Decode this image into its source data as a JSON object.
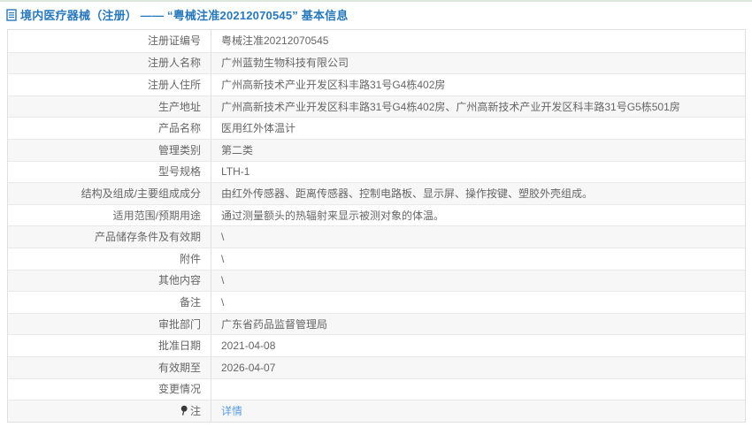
{
  "header": {
    "title": "境内医疗器械（注册） —— “粤械注准20212070545” 基本信息",
    "icon": "document-icon"
  },
  "colors": {
    "title_blue": "#2878bb",
    "link_blue": "#5b9de0",
    "row_alt": "#f7f7f7",
    "border": "#e0e0e0",
    "text": "#666666",
    "top_line": "#dde9dd"
  },
  "table": {
    "rows": [
      {
        "label": "注册证编号",
        "value": "粤械注准20212070545"
      },
      {
        "label": "注册人名称",
        "value": "广州蓝勃生物科技有限公司"
      },
      {
        "label": "注册人住所",
        "value": "广州高新技术产业开发区科丰路31号G4栋402房"
      },
      {
        "label": "生产地址",
        "value": "广州高新技术产业开发区科丰路31号G4栋402房、广州高新技术产业开发区科丰路31号G5栋501房"
      },
      {
        "label": "产品名称",
        "value": "医用红外体温计"
      },
      {
        "label": "管理类别",
        "value": "第二类"
      },
      {
        "label": "型号规格",
        "value": "LTH-1"
      },
      {
        "label": "结构及组成/主要组成成分",
        "value": "由红外传感器、距离传感器、控制电路板、显示屏、操作按键、塑胶外壳组成。"
      },
      {
        "label": "适用范围/预期用途",
        "value": "通过测量额头的热辐射来显示被测对象的体温。"
      },
      {
        "label": "产品储存条件及有效期",
        "value": "\\"
      },
      {
        "label": "附件",
        "value": "\\"
      },
      {
        "label": "其他内容",
        "value": "\\"
      },
      {
        "label": "备注",
        "value": "\\"
      },
      {
        "label": "审批部门",
        "value": "广东省药品监督管理局"
      },
      {
        "label": "批准日期",
        "value": "2021-04-08"
      },
      {
        "label": "有效期至",
        "value": "2026-04-07"
      },
      {
        "label": "变更情况",
        "value": ""
      },
      {
        "label": "注",
        "value": "详情",
        "value_type": "link",
        "label_icon": "pin-icon"
      }
    ]
  }
}
